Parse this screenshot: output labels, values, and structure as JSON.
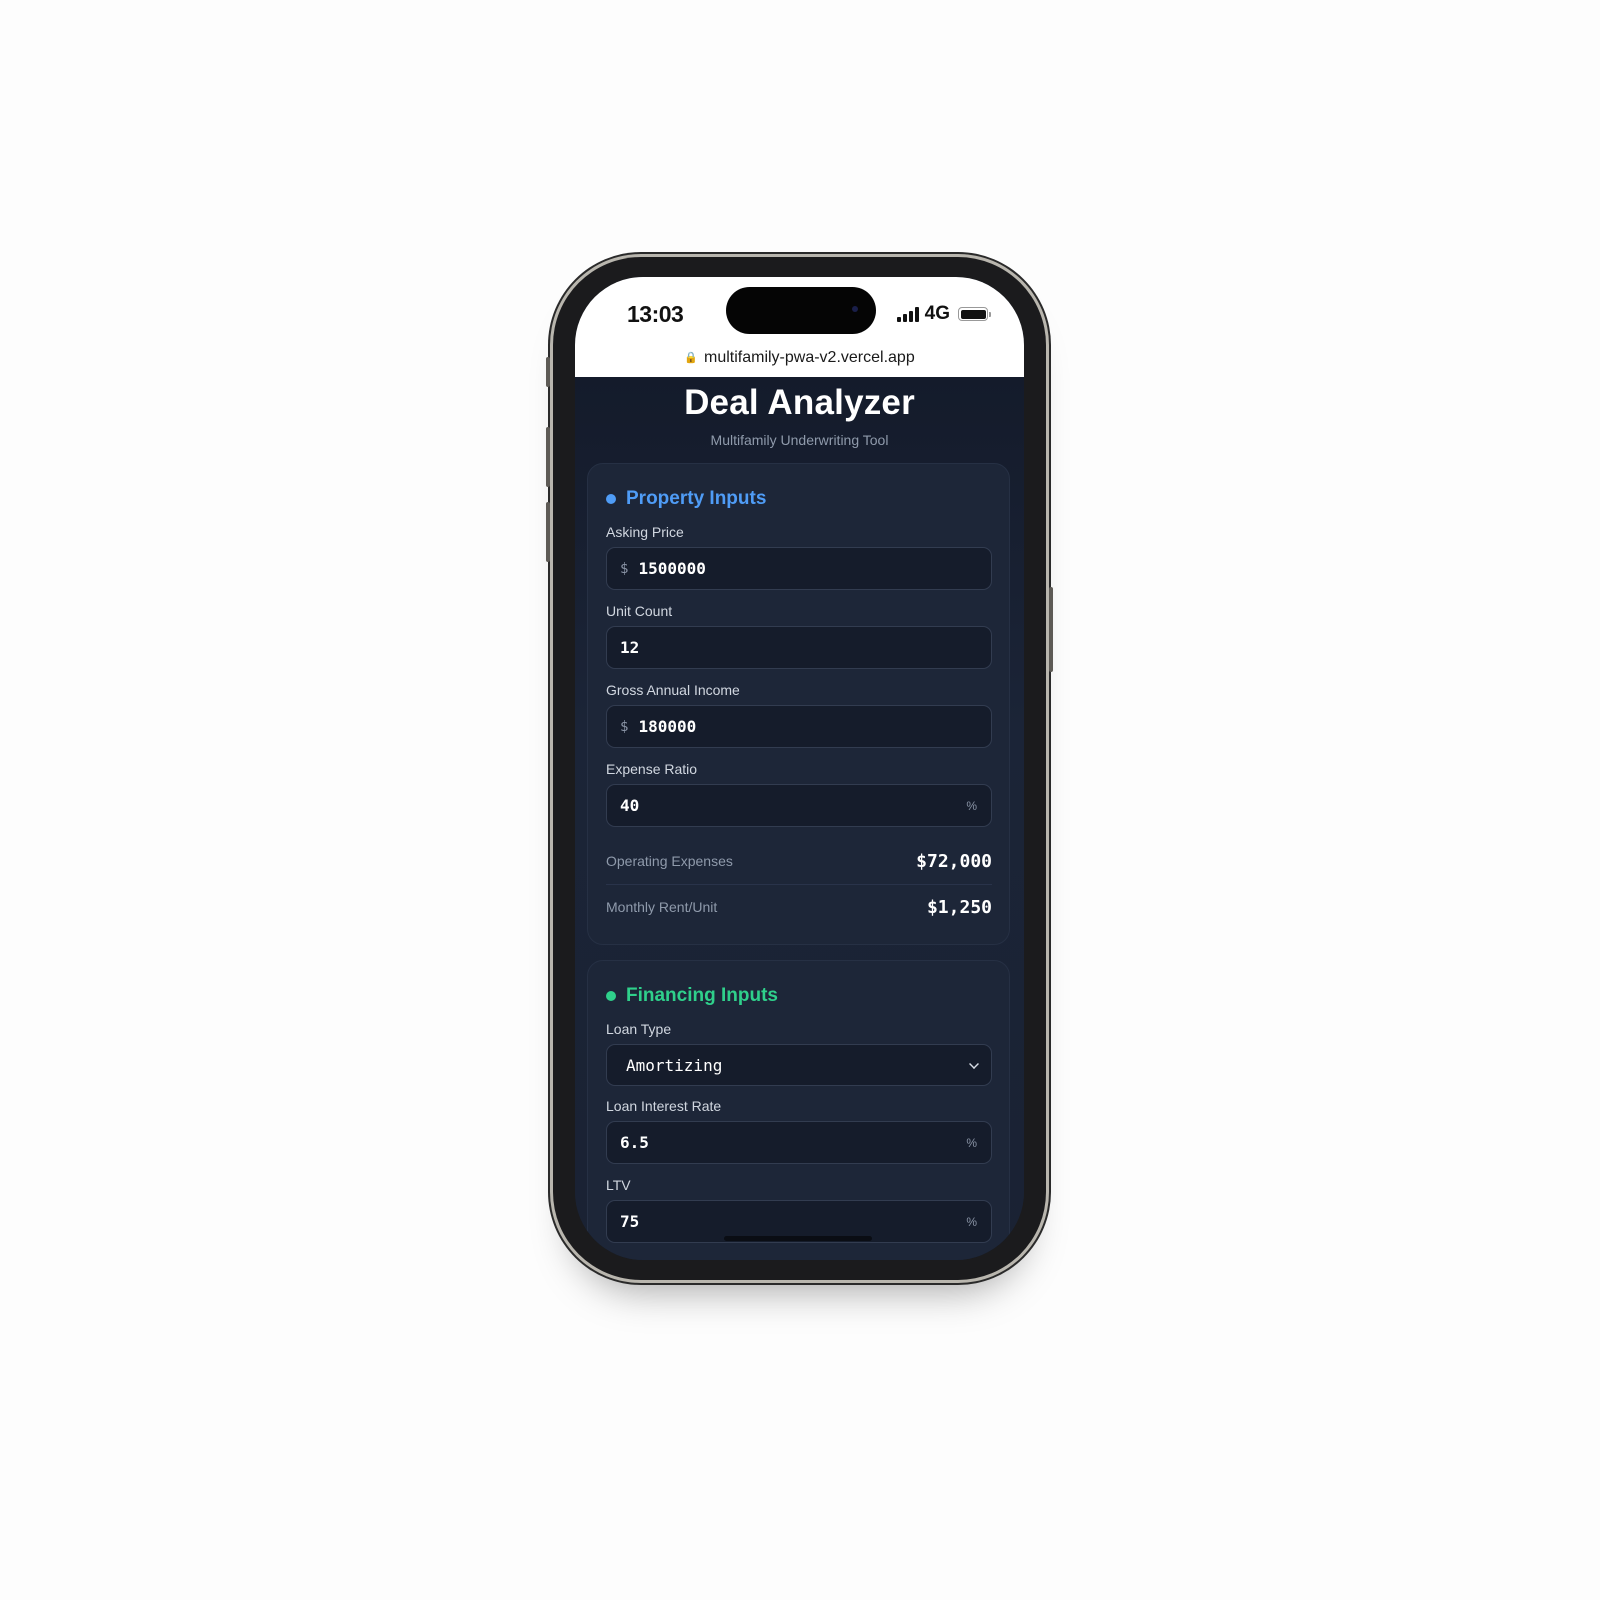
{
  "status_bar": {
    "time": "13:03",
    "network": "4G",
    "icons": [
      "signal-icon",
      "battery-icon"
    ]
  },
  "browser": {
    "url": "multifamily-pwa-v2.vercel.app",
    "lock_icon": "lock-icon"
  },
  "header": {
    "title": "Deal Analyzer",
    "subtitle": "Multifamily Underwriting Tool"
  },
  "property_inputs": {
    "title": "Property Inputs",
    "accent": "#4f9cf6",
    "asking_price": {
      "label": "Asking Price",
      "prefix": "$",
      "value": "1500000"
    },
    "unit_count": {
      "label": "Unit Count",
      "value": "12"
    },
    "gross_annual_income": {
      "label": "Gross Annual Income",
      "prefix": "$",
      "value": "180000"
    },
    "expense_ratio": {
      "label": "Expense Ratio",
      "value": "40",
      "suffix": "%"
    },
    "operating_expenses": {
      "label": "Operating Expenses",
      "value": "$72,000"
    },
    "monthly_rent_unit": {
      "label": "Monthly Rent/Unit",
      "value": "$1,250"
    }
  },
  "financing_inputs": {
    "title": "Financing Inputs",
    "accent": "#2fd08b",
    "loan_type": {
      "label": "Loan Type",
      "value": "Amortizing"
    },
    "loan_interest_rate": {
      "label": "Loan Interest Rate",
      "value": "6.5",
      "suffix": "%"
    },
    "ltv": {
      "label": "LTV",
      "value": "75",
      "suffix": "%"
    }
  }
}
